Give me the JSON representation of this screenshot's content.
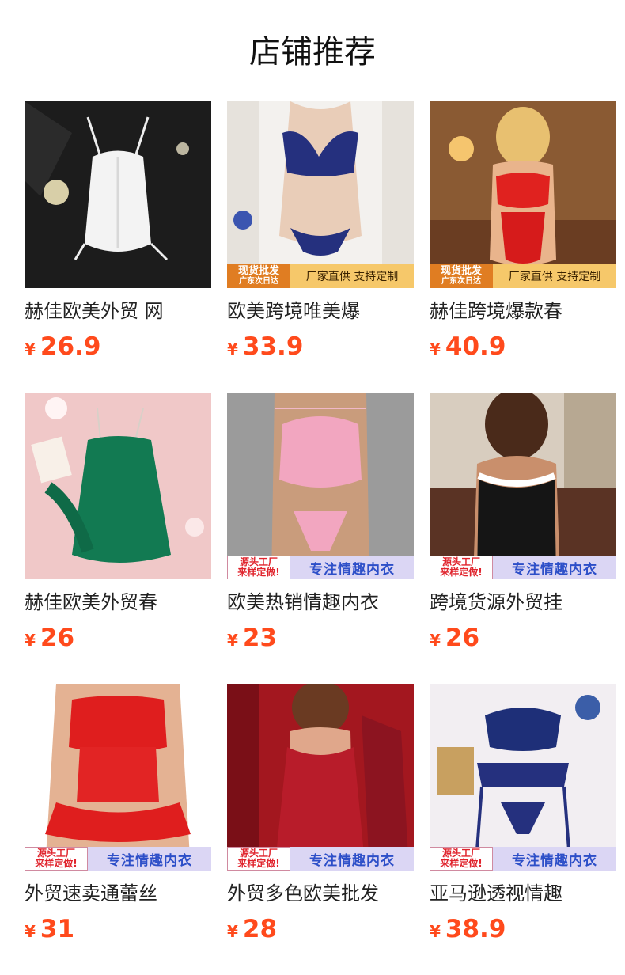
{
  "header": {
    "title": "店铺推荐"
  },
  "products": [
    {
      "name": "赫佳欧美外贸 网",
      "currency": "¥",
      "price": "26.9",
      "image": "white-lace-chemise",
      "badge": null
    },
    {
      "name": "欧美跨境唯美爆",
      "currency": "¥",
      "price": "33.9",
      "image": "navy-lace-set",
      "badge": {
        "style": "a",
        "left_top": "现货批发",
        "left_bottom": "广东次日达",
        "right": "厂家直供 支持定制"
      }
    },
    {
      "name": "赫佳跨境爆款春",
      "currency": "¥",
      "price": "40.9",
      "image": "red-lace-bodysuit",
      "badge": {
        "style": "a",
        "left_top": "现货批发",
        "left_bottom": "广东次日达",
        "right": "厂家直供 支持定制"
      }
    },
    {
      "name": "赫佳欧美外贸春",
      "currency": "¥",
      "price": "26",
      "image": "green-lace-dress",
      "badge": null
    },
    {
      "name": "欧美热销情趣内衣",
      "currency": "¥",
      "price": "23",
      "image": "pink-bow-set",
      "badge": {
        "style": "b",
        "left_top": "源头工厂",
        "left_bottom": "来样定做!",
        "right": "专注情趣内衣"
      }
    },
    {
      "name": "跨境货源外贸挂",
      "currency": "¥",
      "price": "26",
      "image": "maid-costume",
      "badge": {
        "style": "b",
        "left_top": "源头工厂",
        "left_bottom": "来样定做!",
        "right": "专注情趣内衣"
      }
    },
    {
      "name": "外贸速卖通蕾丝",
      "currency": "¥",
      "price": "31",
      "image": "red-peplum-set",
      "badge": {
        "style": "b",
        "left_top": "源头工厂",
        "left_bottom": "来样定做!",
        "right": "专注情趣内衣"
      }
    },
    {
      "name": "外贸多色欧美批发",
      "currency": "¥",
      "price": "28",
      "image": "burgundy-babydoll",
      "badge": {
        "style": "b",
        "left_top": "源头工厂",
        "left_bottom": "来样定做!",
        "right": "专注情趣内衣"
      }
    },
    {
      "name": "亚马逊透视情趣",
      "currency": "¥",
      "price": "38.9",
      "image": "blue-garter-set",
      "badge": {
        "style": "b",
        "left_top": "源头工厂",
        "left_bottom": "来样定做!",
        "right": "专注情趣内衣"
      }
    }
  ]
}
